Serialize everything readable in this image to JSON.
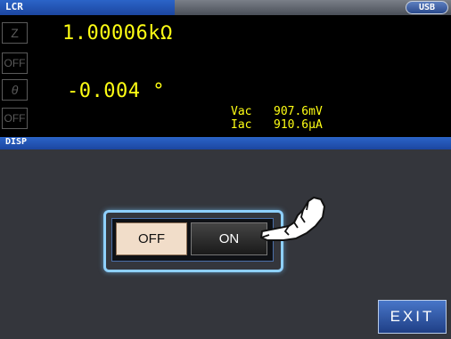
{
  "title_bar": {
    "label": "LCR",
    "usb_badge": "USB"
  },
  "measurement": {
    "param1_label": "Z",
    "param1_value": "1.00006kΩ",
    "param2_label": "OFF",
    "param3_label": "θ",
    "param3_value": "-0.004 °",
    "param4_label": "OFF",
    "monitor": {
      "vac_label": "Vac",
      "vac_value": "907.6mV",
      "iac_label": "Iac",
      "iac_value": "910.6µA"
    }
  },
  "disp_bar": {
    "label": "DISP"
  },
  "disp_toggle": {
    "off_label": "OFF",
    "on_label": "ON",
    "selected": "ON"
  },
  "exit_button": {
    "label": "EXIT"
  },
  "colors": {
    "value_text": "#ffff14",
    "accent_blue": "#1c46a0",
    "highlight": "#8ed0ff"
  }
}
